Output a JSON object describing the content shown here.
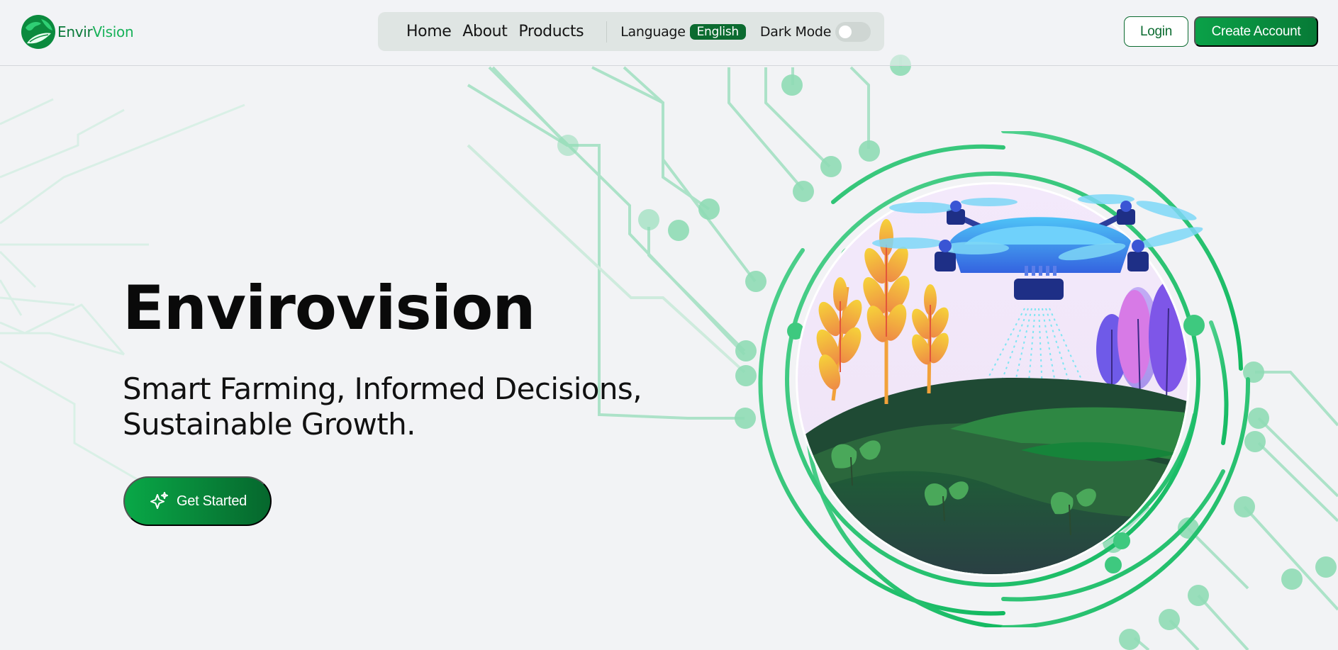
{
  "brand": {
    "name_part1": "Envir",
    "name_part2": "Vision",
    "logo_icon": "globe-leaf-icon"
  },
  "nav": {
    "links": [
      {
        "label": "Home"
      },
      {
        "label": "About"
      },
      {
        "label": "Products"
      }
    ],
    "language_label": "Language",
    "language_value": "English",
    "dark_mode_label": "Dark Mode",
    "dark_mode_on": false
  },
  "auth": {
    "login_label": "Login",
    "create_account_label": "Create Account"
  },
  "hero": {
    "title": "Envirovision",
    "subtitle_line1": "Smart Farming, Informed Decisions,",
    "subtitle_line2": "Sustainable Growth.",
    "cta_label": "Get Started",
    "cta_icon": "sparkle-icon",
    "illustration": "drone-farm-illustration"
  },
  "colors": {
    "brand_dark_green": "#0b6b30",
    "brand_green": "#0aa148",
    "circuit_green": "#3ec97f",
    "background": "#f2f3f5"
  }
}
